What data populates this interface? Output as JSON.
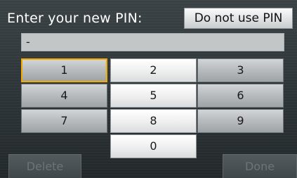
{
  "prompt": "Enter your new PIN:",
  "no_pin_button": "Do not use PIN",
  "pin_field": {
    "value": "-"
  },
  "keypad": [
    {
      "name": "key-1",
      "label": "1",
      "col": 0,
      "row": 0,
      "style": "dark",
      "selected": true
    },
    {
      "name": "key-2",
      "label": "2",
      "col": 1,
      "row": 0,
      "style": "light"
    },
    {
      "name": "key-3",
      "label": "3",
      "col": 2,
      "row": 0,
      "style": "dark"
    },
    {
      "name": "key-4",
      "label": "4",
      "col": 0,
      "row": 1,
      "style": "dark"
    },
    {
      "name": "key-5",
      "label": "5",
      "col": 1,
      "row": 1,
      "style": "light"
    },
    {
      "name": "key-6",
      "label": "6",
      "col": 2,
      "row": 1,
      "style": "dark"
    },
    {
      "name": "key-7",
      "label": "7",
      "col": 0,
      "row": 2,
      "style": "dark"
    },
    {
      "name": "key-8",
      "label": "8",
      "col": 1,
      "row": 2,
      "style": "light"
    },
    {
      "name": "key-9",
      "label": "9",
      "col": 2,
      "row": 2,
      "style": "dark"
    },
    {
      "name": "key-0",
      "label": "0",
      "col": 1,
      "row": 3,
      "style": "light"
    }
  ],
  "delete_button": {
    "label": "Delete",
    "enabled": false
  },
  "done_button": {
    "label": "Done",
    "enabled": false
  },
  "colors": {
    "selection_border": "#f2a900",
    "disabled_text": "#6c7477"
  }
}
